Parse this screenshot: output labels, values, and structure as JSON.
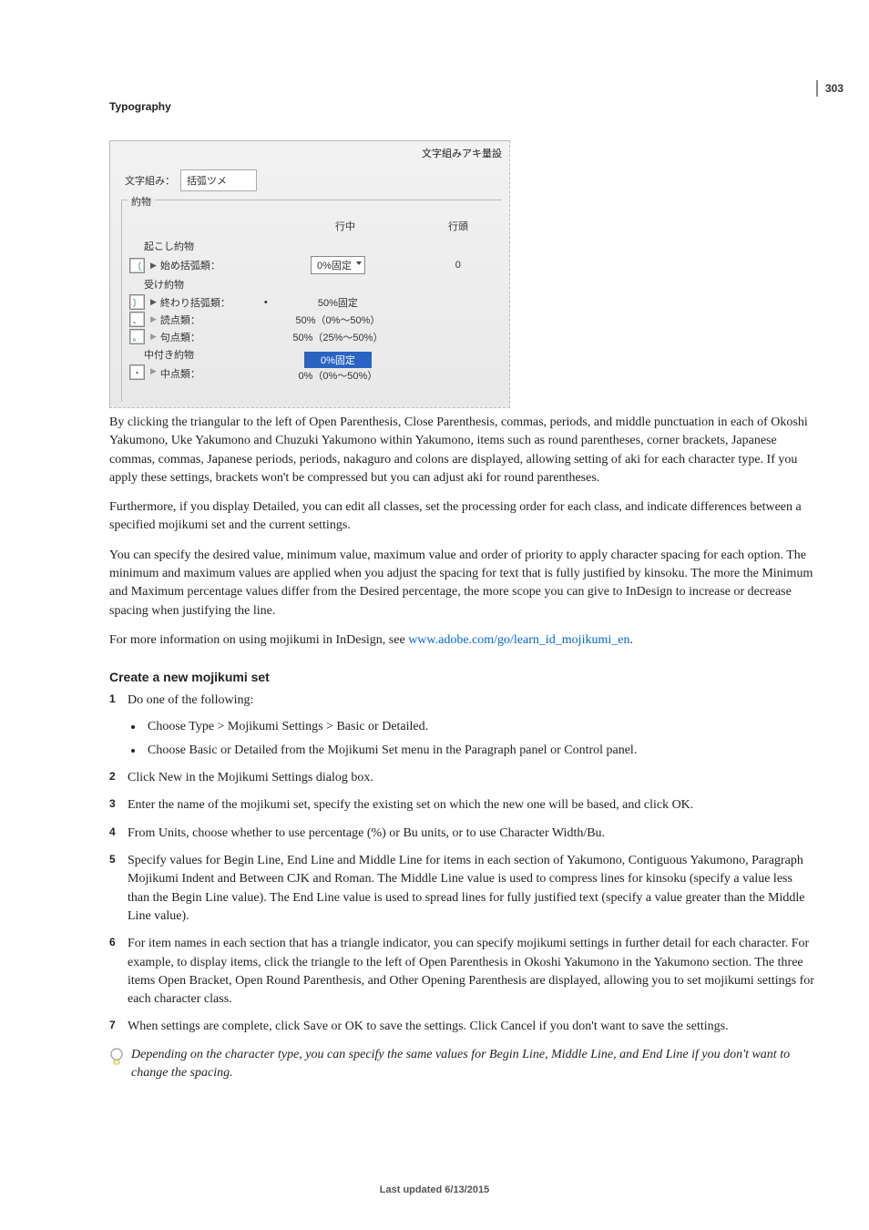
{
  "page_number": "303",
  "section": "Typography",
  "screenshot": {
    "title": "文字組みアキ量設",
    "set_label": "文字組み：",
    "set_value": "括弧ツメ",
    "group_legend": "約物",
    "col_mid": "行中",
    "col_end": "行頭",
    "groups": {
      "okoshi": "起こし約物",
      "uke": "受け約物",
      "chutsuki": "中付き約物"
    },
    "rows": {
      "hajime": {
        "glyph": "〔",
        "label": "始め括弧類：",
        "mid": "0%固定",
        "end": "0"
      },
      "owari": {
        "glyph": "〕",
        "label": "終わり括弧類：",
        "mid": "50%固定"
      },
      "touten": {
        "glyph": "、",
        "label": "読点類：",
        "mid": "50%（0%～50%）"
      },
      "kuten": {
        "glyph": "。",
        "label": "句点類：",
        "mid": "50%（25%～50%）"
      },
      "nakaten": {
        "glyph": "・",
        "label": "中点類：",
        "mid_hl": "0%固定",
        "mid_sub": "0%（0%～50%）"
      }
    }
  },
  "p1": "By clicking the triangular to the left of Open Parenthesis, Close Parenthesis, commas, periods, and middle punctuation in each of Okoshi Yakumono, Uke Yakumono and Chuzuki Yakumono within Yakumono, items such as round parentheses, corner brackets, Japanese commas, commas, Japanese periods, periods, nakaguro and colons are displayed, allowing setting of aki for each character type. If you apply these settings, brackets won't be compressed but you can adjust aki for round parentheses.",
  "p2": "Furthermore, if you display Detailed, you can edit all classes, set the processing order for each class, and indicate differences between a specified mojikumi set and the current settings.",
  "p3": "You can specify the desired value, minimum value, maximum value and order of priority to apply character spacing for each option. The minimum and maximum values are applied when you adjust the spacing for text that is fully justified by kinsoku. The more the Minimum and Maximum percentage values differ from the Desired percentage, the more scope you can give to InDesign to increase or decrease spacing when justifying the line.",
  "p4_a": "For more information on using mojikumi in InDesign, see ",
  "p4_link": "www.adobe.com/go/learn_id_mojikumi_en",
  "p4_b": ".",
  "h3": "Create a new mojikumi set",
  "steps": {
    "s1": "Do one of the following:",
    "s1a": "Choose Type > Mojikumi Settings > Basic or Detailed.",
    "s1b": "Choose Basic or Detailed from the Mojikumi Set menu in the Paragraph panel or Control panel.",
    "s2": "Click New in the Mojikumi Settings dialog box.",
    "s3": "Enter the name of the mojikumi set, specify the existing set on which the new one will be based, and click OK.",
    "s4": "From Units, choose whether to use percentage (%) or Bu units, or to use Character Width/Bu.",
    "s5": "Specify values for Begin Line, End Line and Middle Line for items in each section of Yakumono, Contiguous Yakumono, Paragraph Mojikumi Indent and Between CJK and Roman. The Middle Line value is used to compress lines for kinsoku (specify a value less than the Begin Line value). The End Line value is used to spread lines for fully justified text (specify a value greater than the Middle Line value).",
    "s6": "For item names in each section that has a triangle indicator, you can specify mojikumi settings in further detail for each character. For example, to display items, click the triangle to the left of Open Parenthesis in Okoshi Yakumono in the Yakumono section. The three items Open Bracket, Open Round Parenthesis, and Other Opening Parenthesis are displayed, allowing you to set mojikumi settings for each character class.",
    "s7": "When settings are complete, click Save or OK to save the settings. Click Cancel if you don't want to save the settings."
  },
  "note": "Depending on the character type, you can specify the same values for Begin Line, Middle Line, and End Line if you don't want to change the spacing.",
  "footer": "Last updated 6/13/2015"
}
